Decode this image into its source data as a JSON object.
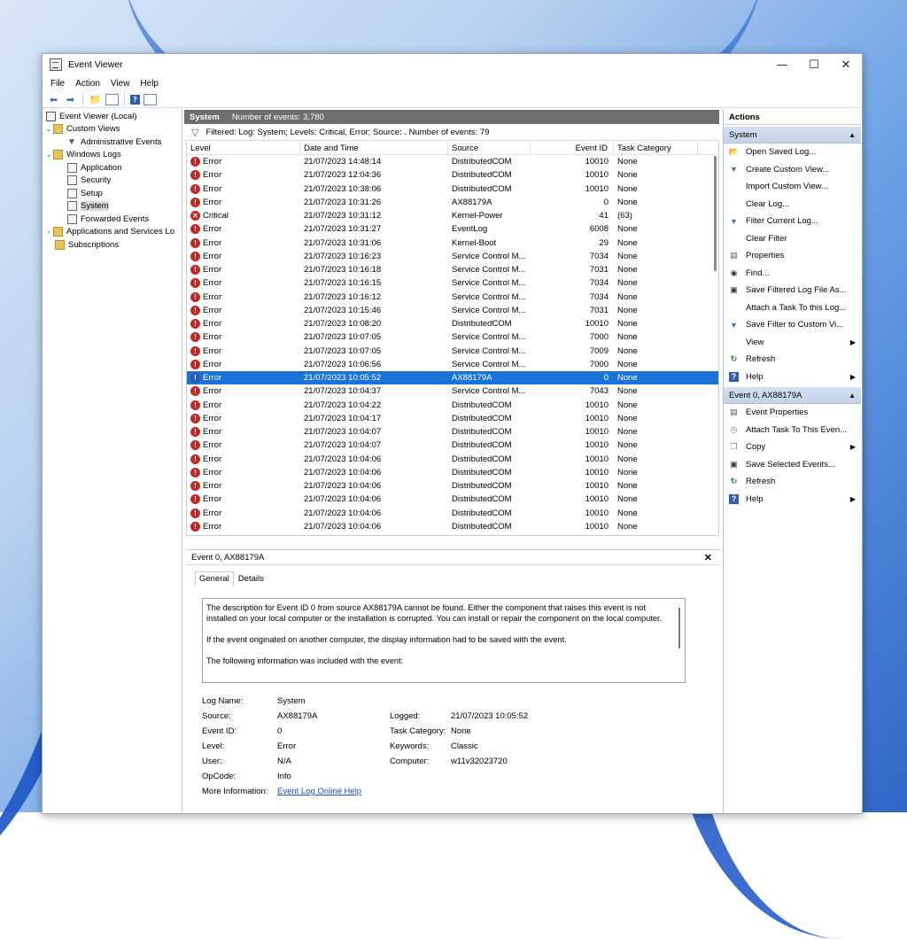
{
  "window": {
    "title": "Event Viewer"
  },
  "menu": [
    "File",
    "Action",
    "View",
    "Help"
  ],
  "tree": {
    "root": "Event Viewer (Local)",
    "custom_views": "Custom Views",
    "administrative_events": "Administrative Events",
    "windows_logs": "Windows Logs",
    "application": "Application",
    "security": "Security",
    "setup": "Setup",
    "system": "System",
    "forwarded_events": "Forwarded Events",
    "applications_services": "Applications and Services Lo",
    "subscriptions": "Subscriptions"
  },
  "main": {
    "title": "System",
    "event_count": "Number of events: 3,780",
    "filter_text": "Filtered: Log: System; Levels: Critical, Error; Source: . Number of events: 79",
    "columns": {
      "level": "Level",
      "date": "Date and Time",
      "source": "Source",
      "event_id": "Event ID",
      "task": "Task Category"
    }
  },
  "events": [
    {
      "level": "Error",
      "date": "21/07/2023 14:48:14",
      "source": "DistributedCOM",
      "id": "10010",
      "task": "None"
    },
    {
      "level": "Error",
      "date": "21/07/2023 12:04:36",
      "source": "DistributedCOM",
      "id": "10010",
      "task": "None"
    },
    {
      "level": "Error",
      "date": "21/07/2023 10:38:06",
      "source": "DistributedCOM",
      "id": "10010",
      "task": "None"
    },
    {
      "level": "Error",
      "date": "21/07/2023 10:31:26",
      "source": "AX88179A",
      "id": "0",
      "task": "None"
    },
    {
      "level": "Critical",
      "date": "21/07/2023 10:31:12",
      "source": "Kernel-Power",
      "id": "41",
      "task": "(63)"
    },
    {
      "level": "Error",
      "date": "21/07/2023 10:31:27",
      "source": "EventLog",
      "id": "6008",
      "task": "None"
    },
    {
      "level": "Error",
      "date": "21/07/2023 10:31:06",
      "source": "Kernel-Boot",
      "id": "29",
      "task": "None"
    },
    {
      "level": "Error",
      "date": "21/07/2023 10:16:23",
      "source": "Service Control M...",
      "id": "7034",
      "task": "None"
    },
    {
      "level": "Error",
      "date": "21/07/2023 10:16:18",
      "source": "Service Control M...",
      "id": "7031",
      "task": "None"
    },
    {
      "level": "Error",
      "date": "21/07/2023 10:16:15",
      "source": "Service Control M...",
      "id": "7034",
      "task": "None"
    },
    {
      "level": "Error",
      "date": "21/07/2023 10:16:12",
      "source": "Service Control M...",
      "id": "7034",
      "task": "None"
    },
    {
      "level": "Error",
      "date": "21/07/2023 10:15:46",
      "source": "Service Control M...",
      "id": "7031",
      "task": "None"
    },
    {
      "level": "Error",
      "date": "21/07/2023 10:08:20",
      "source": "DistributedCOM",
      "id": "10010",
      "task": "None"
    },
    {
      "level": "Error",
      "date": "21/07/2023 10:07:05",
      "source": "Service Control M...",
      "id": "7000",
      "task": "None"
    },
    {
      "level": "Error",
      "date": "21/07/2023 10:07:05",
      "source": "Service Control M...",
      "id": "7009",
      "task": "None"
    },
    {
      "level": "Error",
      "date": "21/07/2023 10:06:56",
      "source": "Service Control M...",
      "id": "7000",
      "task": "None"
    },
    {
      "level": "Error",
      "date": "21/07/2023 10:05:52",
      "source": "AX88179A",
      "id": "0",
      "task": "None",
      "selected": true
    },
    {
      "level": "Error",
      "date": "21/07/2023 10:04:37",
      "source": "Service Control M...",
      "id": "7043",
      "task": "None"
    },
    {
      "level": "Error",
      "date": "21/07/2023 10:04:22",
      "source": "DistributedCOM",
      "id": "10010",
      "task": "None"
    },
    {
      "level": "Error",
      "date": "21/07/2023 10:04:17",
      "source": "DistributedCOM",
      "id": "10010",
      "task": "None"
    },
    {
      "level": "Error",
      "date": "21/07/2023 10:04:07",
      "source": "DistributedCOM",
      "id": "10010",
      "task": "None"
    },
    {
      "level": "Error",
      "date": "21/07/2023 10:04:07",
      "source": "DistributedCOM",
      "id": "10010",
      "task": "None"
    },
    {
      "level": "Error",
      "date": "21/07/2023 10:04:06",
      "source": "DistributedCOM",
      "id": "10010",
      "task": "None"
    },
    {
      "level": "Error",
      "date": "21/07/2023 10:04:06",
      "source": "DistributedCOM",
      "id": "10010",
      "task": "None"
    },
    {
      "level": "Error",
      "date": "21/07/2023 10:04:06",
      "source": "DistributedCOM",
      "id": "10010",
      "task": "None"
    },
    {
      "level": "Error",
      "date": "21/07/2023 10:04:06",
      "source": "DistributedCOM",
      "id": "10010",
      "task": "None"
    },
    {
      "level": "Error",
      "date": "21/07/2023 10:04:06",
      "source": "DistributedCOM",
      "id": "10010",
      "task": "None"
    },
    {
      "level": "Error",
      "date": "21/07/2023 10:04:06",
      "source": "DistributedCOM",
      "id": "10010",
      "task": "None"
    }
  ],
  "detail": {
    "title": "Event 0, AX88179A",
    "tab_general": "General",
    "tab_details": "Details",
    "desc1": "The description for Event ID 0 from source AX88179A cannot be found. Either the component that raises this event is not installed on your local computer or the installation is corrupted. You can install or repair the component on the local computer.",
    "desc2": "If the event originated on another computer, the display information had to be saved with the event.",
    "desc3": "The following information was included with the event:",
    "log_name_label": "Log Name:",
    "log_name": "System",
    "source_label": "Source:",
    "source": "AX88179A",
    "logged_label": "Logged:",
    "logged": "21/07/2023 10:05:52",
    "event_id_label": "Event ID:",
    "event_id": "0",
    "task_label": "Task Category:",
    "task": "None",
    "level_label": "Level:",
    "level": "Error",
    "keywords_label": "Keywords:",
    "keywords": "Classic",
    "user_label": "User:",
    "user": "N/A",
    "computer_label": "Computer:",
    "computer": "w11v32023720",
    "opcode_label": "OpCode:",
    "opcode": "Info",
    "more_info_label": "More Information:",
    "more_info_link": "Event Log Online Help"
  },
  "actions": {
    "title": "Actions",
    "section_system": "System",
    "system_items": [
      {
        "label": "Open Saved Log...",
        "icon": "folder-open-icon"
      },
      {
        "label": "Create Custom View...",
        "icon": "filter-icon"
      },
      {
        "label": "Import Custom View...",
        "icon": ""
      },
      {
        "label": "Clear Log...",
        "icon": ""
      },
      {
        "label": "Filter Current Log...",
        "icon": "filter-icon"
      },
      {
        "label": "Clear Filter",
        "icon": ""
      },
      {
        "label": "Properties",
        "icon": "properties-icon"
      },
      {
        "label": "Find...",
        "icon": "binoculars-icon"
      },
      {
        "label": "Save Filtered Log File As...",
        "icon": "save-icon"
      },
      {
        "label": "Attach a Task To this Log...",
        "icon": ""
      },
      {
        "label": "Save Filter to Custom Vi...",
        "icon": "save-filter-icon"
      },
      {
        "label": "View",
        "icon": "",
        "submenu": true
      },
      {
        "label": "Refresh",
        "icon": "refresh-icon"
      },
      {
        "label": "Help",
        "icon": "help-icon",
        "submenu": true
      }
    ],
    "section_event": "Event 0, AX88179A",
    "event_items": [
      {
        "label": "Event Properties",
        "icon": "properties-icon"
      },
      {
        "label": "Attach Task To This Even...",
        "icon": "task-icon"
      },
      {
        "label": "Copy",
        "icon": "copy-icon",
        "submenu": true
      },
      {
        "label": "Save Selected Events...",
        "icon": "save-icon"
      },
      {
        "label": "Refresh",
        "icon": "refresh-icon"
      },
      {
        "label": "Help",
        "icon": "help-icon",
        "submenu": true
      }
    ]
  },
  "colors": {
    "selection": "#1a73d7",
    "header_gray": "#6e6e6e",
    "error_red": "#c9241f",
    "link": "#1a4bd6"
  }
}
